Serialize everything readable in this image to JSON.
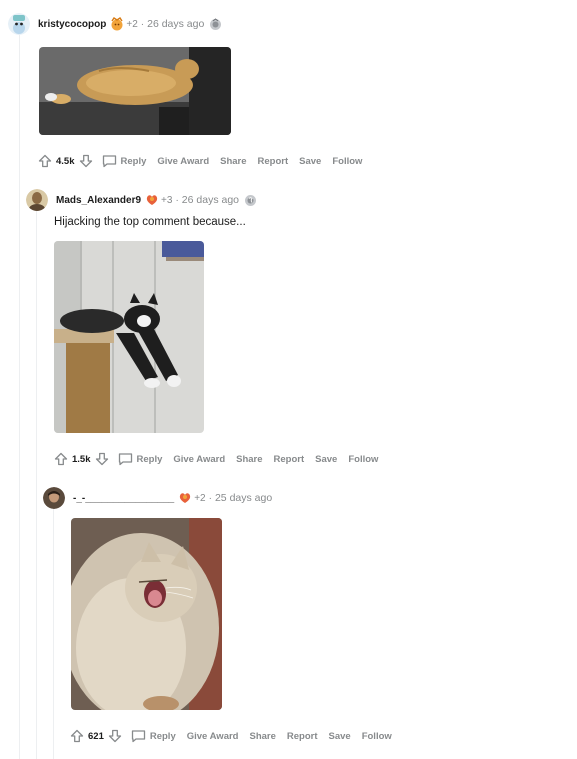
{
  "comments": [
    {
      "username": "kristycocopop",
      "award_count": "+2",
      "separator": "·",
      "time": "26 days ago",
      "votes": "4.5k",
      "actions": {
        "reply": "Reply",
        "give_award": "Give Award",
        "share": "Share",
        "report": "Report",
        "save": "Save",
        "follow": "Follow"
      }
    },
    {
      "username": "Mads_Alexander9",
      "award_count": "+3",
      "separator": "·",
      "time": "26 days ago",
      "body": "Hijacking the top comment because...",
      "votes": "1.5k",
      "actions": {
        "reply": "Reply",
        "give_award": "Give Award",
        "share": "Share",
        "report": "Report",
        "save": "Save",
        "follow": "Follow"
      }
    },
    {
      "username": "-_-________________",
      "award_count": "+2",
      "separator": "·",
      "time": "25 days ago",
      "votes": "621",
      "actions": {
        "reply": "Reply",
        "give_award": "Give Award",
        "share": "Share",
        "report": "Report",
        "save": "Save",
        "follow": "Follow"
      }
    }
  ],
  "icons": {
    "upvote": "arrow-up-icon",
    "downvote": "arrow-down-icon",
    "reply": "speech-bubble-icon",
    "award_primary": "gold-award-icon",
    "award_secondary": "silver-award-icon"
  },
  "colors": {
    "meta_gray": "#878a8c",
    "thread_line": "#edeff1",
    "award_gold": "#f2a43a"
  }
}
